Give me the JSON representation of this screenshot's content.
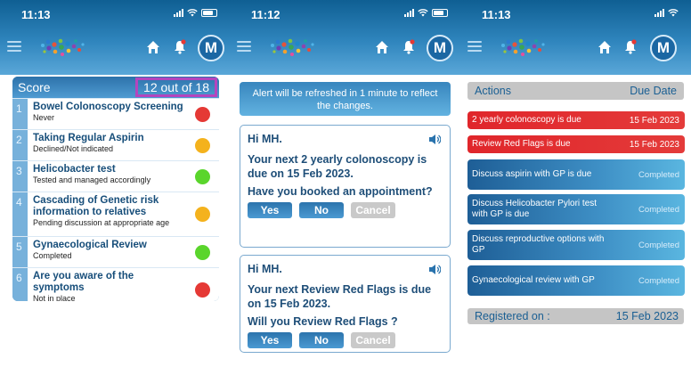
{
  "screens": [
    {
      "time": "11:13",
      "avatar": "M",
      "score": {
        "label": "Score",
        "value": "12 out of 18",
        "items": [
          {
            "num": "1",
            "title": "Bowel Colonoscopy Screening",
            "status": "Never",
            "color": "#e53935"
          },
          {
            "num": "2",
            "title": "Taking Regular Aspirin",
            "status": "Declined/Not indicated",
            "color": "#f4b21d"
          },
          {
            "num": "3",
            "title": "Helicobacter test",
            "status": "Tested and managed accordingly",
            "color": "#5ad52c"
          },
          {
            "num": "4",
            "title": "Cascading of Genetic risk information to relatives",
            "status": "Pending discussion at appropriate age",
            "color": "#f4b21d"
          },
          {
            "num": "5",
            "title": "Gynaecological Review",
            "status": "Completed",
            "color": "#5ad52c"
          },
          {
            "num": "6",
            "title": "Are you aware of the symptoms",
            "status": "Not in place",
            "color": "#e53935"
          }
        ]
      }
    },
    {
      "time": "11:12",
      "avatar": "M",
      "alert": "Alert will be refreshed in 1 minute to reflect the changes.",
      "messages": [
        {
          "greeting": "Hi MH.",
          "text": "Your next 2 yearly colonoscopy is due on 15 Feb 2023.",
          "question": "Have you booked an appointment?",
          "yes": "Yes",
          "no": "No",
          "cancel": "Cancel"
        },
        {
          "greeting": "Hi MH.",
          "text": "Your next Review Red Flags is due on 15 Feb 2023.",
          "question": "Will you Review Red Flags ?",
          "yes": "Yes",
          "no": "No",
          "cancel": "Cancel"
        }
      ]
    },
    {
      "time": "11:13",
      "avatar": "M",
      "actions_header": {
        "left": "Actions",
        "right": "Due Date"
      },
      "actions": [
        {
          "label": "2 yearly colonoscopy is due",
          "date": "15 Feb 2023",
          "kind": "red"
        },
        {
          "label": "Review Red Flags is due",
          "date": "15 Feb 2023",
          "kind": "red"
        },
        {
          "label": "Discuss aspirin with GP is due",
          "date": "Completed",
          "kind": "blue"
        },
        {
          "label": "Discuss Helicobacter Pylori test with GP is due",
          "date": "Completed",
          "kind": "blue"
        },
        {
          "label": "Discuss reproductive options with GP",
          "date": "Completed",
          "kind": "blue"
        },
        {
          "label": "Gynaecological review with GP",
          "date": "Completed",
          "kind": "blue"
        }
      ],
      "registered": {
        "label": "Registered on :",
        "date": "15 Feb 2023"
      }
    }
  ],
  "icons": [
    "menu-icon",
    "logo-icon",
    "home-icon",
    "bell-icon",
    "speaker-icon",
    "wifi-icon",
    "battery-icon",
    "signal-icon"
  ]
}
